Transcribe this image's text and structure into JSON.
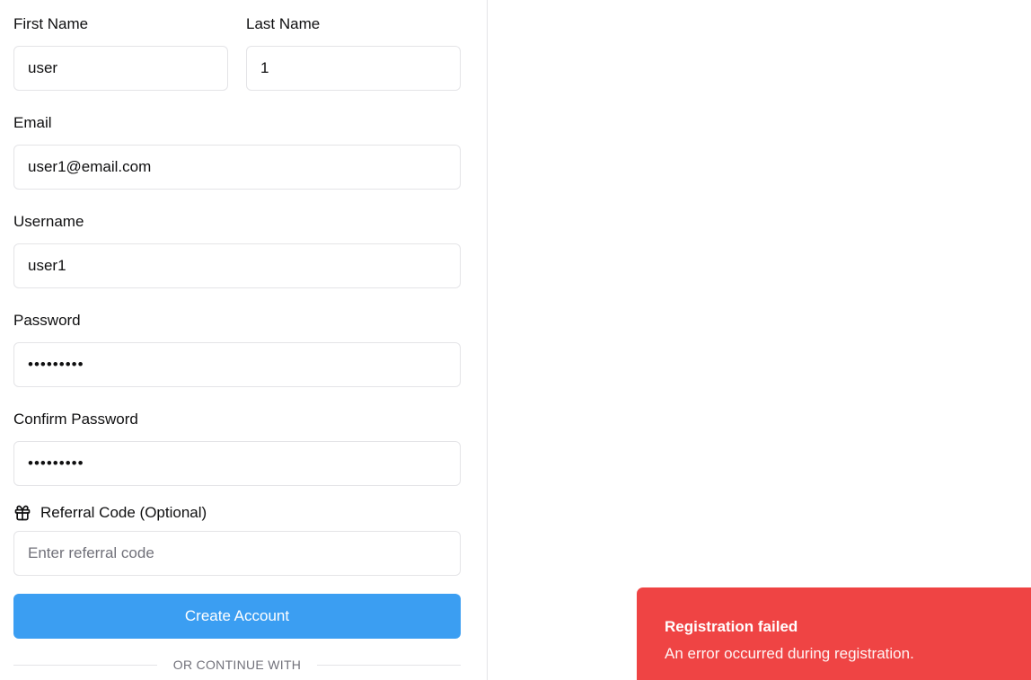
{
  "form": {
    "first_name": {
      "label": "First Name",
      "value": "user"
    },
    "last_name": {
      "label": "Last Name",
      "value": "1"
    },
    "email": {
      "label": "Email",
      "value": "user1@email.com"
    },
    "username": {
      "label": "Username",
      "value": "user1"
    },
    "password": {
      "label": "Password",
      "value": "•••••••••"
    },
    "confirm_password": {
      "label": "Confirm Password",
      "value": "•••••••••"
    },
    "referral": {
      "label": "Referral Code (Optional)",
      "placeholder": "Enter referral code",
      "icon": "gift-icon"
    },
    "submit_label": "Create Account",
    "divider_text": "OR CONTINUE WITH"
  },
  "toast": {
    "title": "Registration failed",
    "description": "An error occurred during registration.",
    "color": "#ef4444"
  },
  "colors": {
    "primary_button": "#3b9ef2",
    "border": "#e4e4e7",
    "muted_text": "#71717a"
  }
}
